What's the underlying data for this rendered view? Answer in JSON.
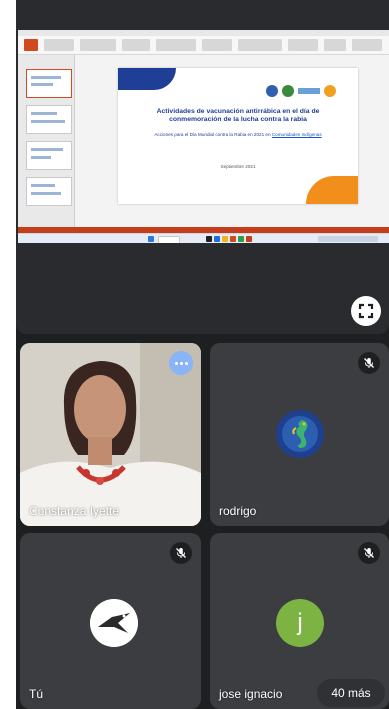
{
  "slide": {
    "title": "Actividades de vacunación antirrábica en el día de conmemoración de la lucha contra la rabia",
    "body": "Acciones para el Día Mundial contra la Rabia en 2021 en",
    "link": "Comunidades Indígenas",
    "date": "Septiembre 2021"
  },
  "participants": [
    {
      "name": "Constanza Iyette",
      "muted": false,
      "more_options": true
    },
    {
      "name": "rodrigo",
      "muted": true,
      "avatar": "seahorse-avatar-icon"
    },
    {
      "name": "Tú",
      "muted": true,
      "avatar": "bird-avatar-icon"
    },
    {
      "name": "jose ignacio",
      "muted": true,
      "avatar_letter": "j",
      "avatar_color": "#7cb342"
    }
  ],
  "overflow": {
    "label": "40 más"
  },
  "icons": {
    "fullscreen": "fullscreen-icon",
    "muted": "mic-off-icon",
    "options": "more-options-icon"
  },
  "colors": {
    "background": "#1e1f21",
    "tile": "#3c3d41",
    "accent": "#8ab4f8",
    "ppt": "#c43e1c"
  }
}
